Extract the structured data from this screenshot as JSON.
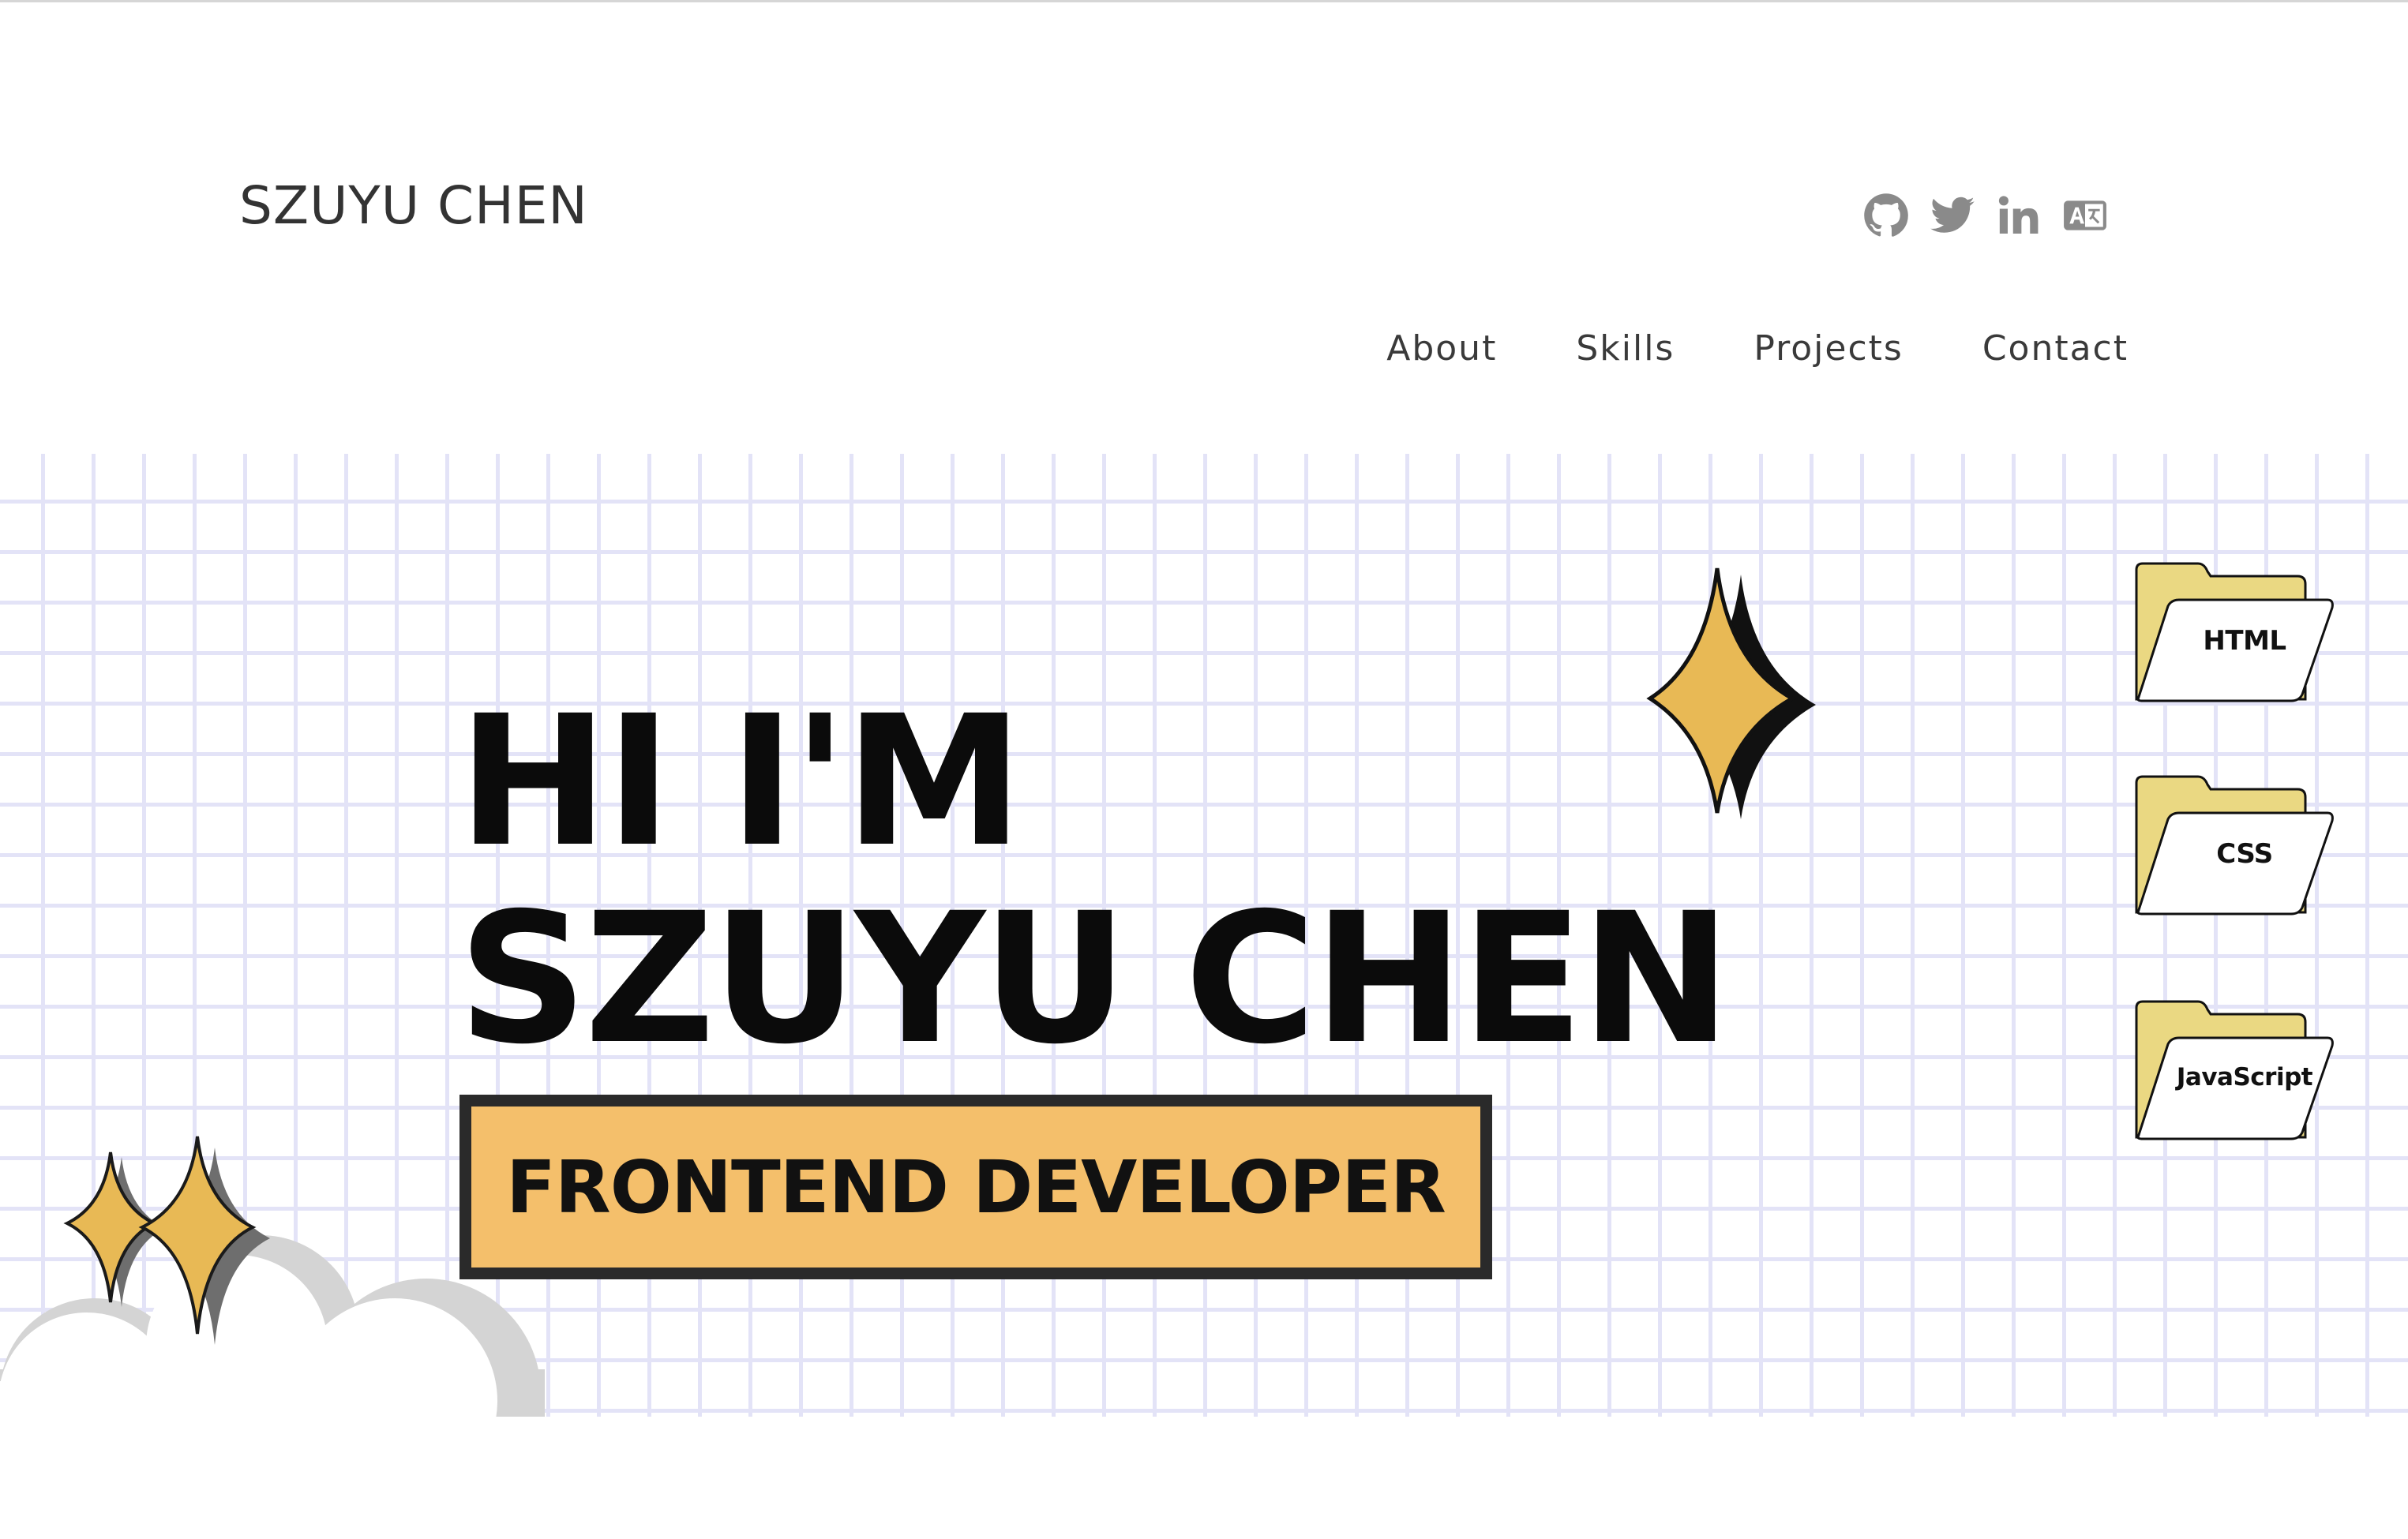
{
  "header": {
    "logo": "SZUYU CHEN",
    "socials": [
      {
        "icon": "github-icon"
      },
      {
        "icon": "twitter-icon"
      },
      {
        "icon": "linkedin-icon"
      },
      {
        "icon": "translate-icon"
      }
    ]
  },
  "nav": {
    "items": [
      "About",
      "Skills",
      "Projects",
      "Contact"
    ]
  },
  "hero": {
    "title_line1": "HI I'M",
    "title_line2": "SZUYU CHEN",
    "role": "FRONTEND DEVELOPER",
    "folders": [
      "HTML",
      "CSS",
      "JavaScript"
    ]
  },
  "colors": {
    "accent_yellow": "#f4bf6b",
    "sparkle_gold": "#e8b955",
    "grid_line": "#e3e3f7",
    "text_dark": "#0b0b0b",
    "icon_gray": "#8a8a8a",
    "folder_tab": "#ead882"
  }
}
